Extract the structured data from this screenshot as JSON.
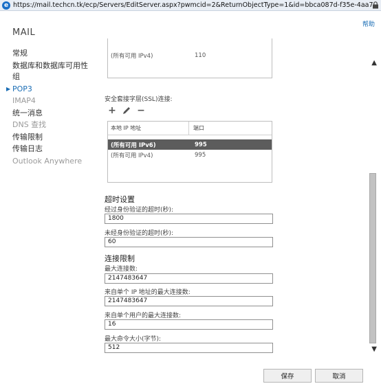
{
  "browser": {
    "url": "https://mail.techcn.tk/ecp/Servers/EditServer.aspx?pwmcid=2&ReturnObjectType=1&id=bbca087d-f35e-4aa7-acf4-ecfbba"
  },
  "header": {
    "help_label": "帮助",
    "title": "MAIL"
  },
  "nav": {
    "items": [
      {
        "label": "常规"
      },
      {
        "label": "数据库和数据库可用性组"
      },
      {
        "label": "POP3"
      },
      {
        "label": "IMAP4"
      },
      {
        "label": "统一消息"
      },
      {
        "label": "DNS 查找"
      },
      {
        "label": "传输限制"
      },
      {
        "label": "传输日志"
      },
      {
        "label": "Outlook Anywhere"
      }
    ]
  },
  "bindings_top": {
    "rows": [
      {
        "ip": "(所有可用 IPv4)",
        "port": "110"
      }
    ]
  },
  "ssl": {
    "label": "安全套接字层(SSL)连接:",
    "add_icon": "plus-icon",
    "edit_icon": "pencil-icon",
    "remove_icon": "minus-icon",
    "columns": [
      "本地 IP 地址",
      "端口"
    ],
    "rows": [
      {
        "ip": "(所有可用 IPv6)",
        "port": "995",
        "selected": true
      },
      {
        "ip": "(所有可用 IPv4)",
        "port": "995",
        "selected": false
      }
    ]
  },
  "timeouts": {
    "heading": "超时设置",
    "auth_label": "经过身份验证的超时(秒):",
    "auth_value": "1800",
    "unauth_label": "未经身份验证的超时(秒):",
    "unauth_value": "60"
  },
  "limits": {
    "heading": "连接限制",
    "max_conn_label": "最大连接数:",
    "max_conn_value": "2147483647",
    "max_ip_label": "来自单个 IP 地址的最大连接数:",
    "max_ip_value": "2147483647",
    "max_user_label": "来自单个用户的最大连接数:",
    "max_user_value": "16",
    "max_cmd_label": "最大命令大小(字节):",
    "max_cmd_value": "512"
  },
  "footer": {
    "save_label": "保存",
    "cancel_label": "取消"
  },
  "colors": {
    "accent": "#1a6db5",
    "selected_row": "#5c5c5c"
  }
}
